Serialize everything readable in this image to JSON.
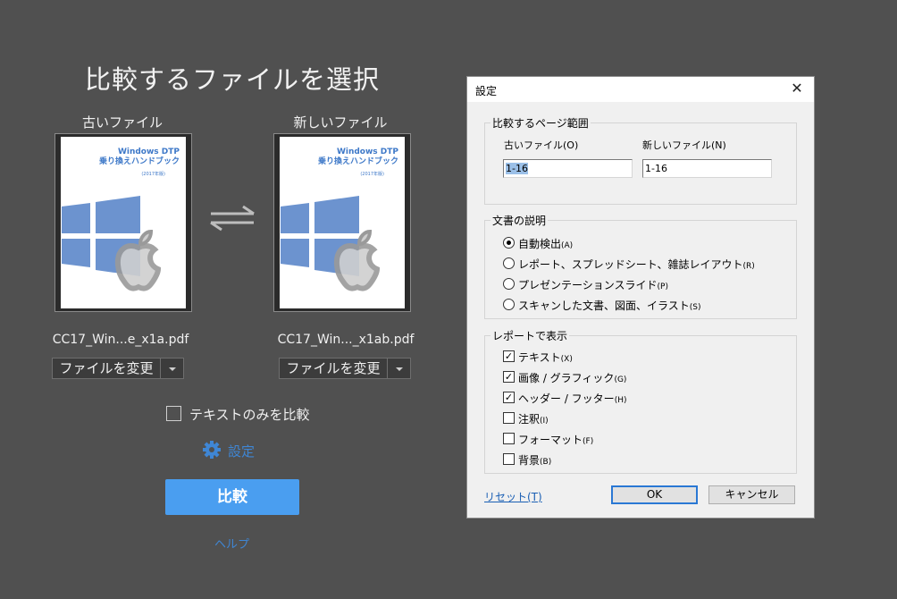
{
  "compare": {
    "title": "比較するファイルを選択",
    "old": {
      "label": "古いファイル",
      "filename": "CC17_Win...e_x1a.pdf",
      "change_button": "ファイルを変更",
      "thumb_title": "Windows DTP\n乗り換えハンドブック",
      "thumb_sub": "(2017年版)"
    },
    "new": {
      "label": "新しいファイル",
      "filename": "CC17_Win..._x1ab.pdf",
      "change_button": "ファイルを変更",
      "thumb_title": "Windows DTP\n乗り換えハンドブック",
      "thumb_sub": "(2017年版)"
    },
    "text_only_label": "テキストのみを比較",
    "text_only_checked": false,
    "settings_link": "設定",
    "compare_button": "比較",
    "help_link": "ヘルプ",
    "colors": {
      "background": "#505050",
      "accent": "#4a9ef0",
      "link": "#3f86d4"
    }
  },
  "dialog": {
    "title": "設定",
    "close": "✕",
    "page_range": {
      "label": "比較するページ範囲",
      "old_label": "古いファイル(O)",
      "new_label": "新しいファイル(N)",
      "old_value": "1-16",
      "new_value": "1-16"
    },
    "doc_desc": {
      "label": "文書の説明",
      "options": [
        {
          "text": "自動検出",
          "key": "(A)",
          "checked": true
        },
        {
          "text": "レポート、スプレッドシート、雑誌レイアウト",
          "key": "(R)",
          "checked": false
        },
        {
          "text": "プレゼンテーションスライド",
          "key": "(P)",
          "checked": false
        },
        {
          "text": "スキャンした文書、図面、イラスト",
          "key": "(S)",
          "checked": false
        }
      ]
    },
    "report": {
      "label": "レポートで表示",
      "items": [
        {
          "text": "テキスト",
          "key": "(X)",
          "checked": true
        },
        {
          "text": "画像 / グラフィック",
          "key": "(G)",
          "checked": true
        },
        {
          "text": "ヘッダー / フッター",
          "key": "(H)",
          "checked": true
        },
        {
          "text": "注釈",
          "key": "(I)",
          "checked": false
        },
        {
          "text": "フォーマット",
          "key": "(F)",
          "checked": false
        },
        {
          "text": "背景",
          "key": "(B)",
          "checked": false
        }
      ]
    },
    "reset": "リセット(T)",
    "ok": "OK",
    "cancel": "キャンセル"
  }
}
